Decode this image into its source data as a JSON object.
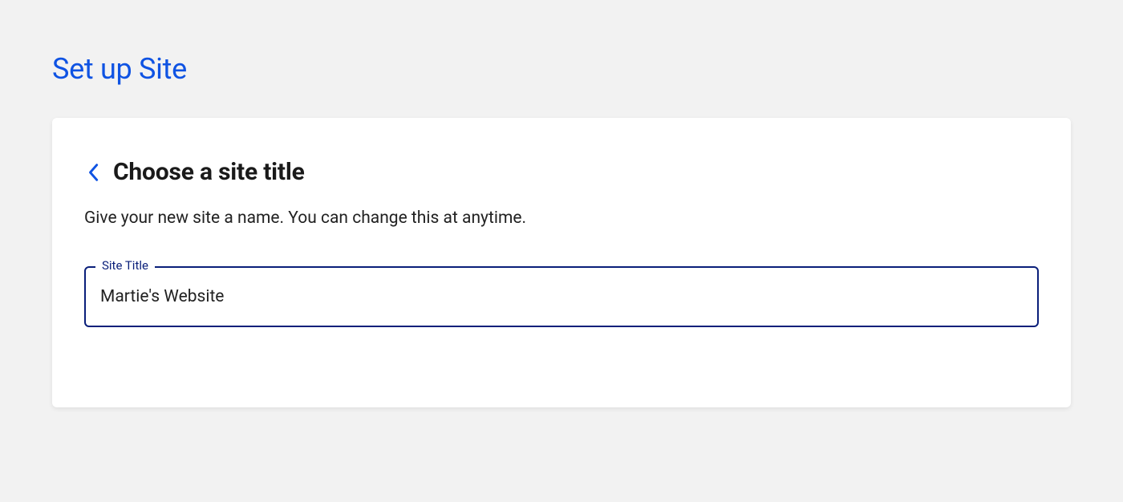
{
  "page": {
    "title": "Set up Site"
  },
  "card": {
    "title": "Choose a site title",
    "subtitle": "Give your new site a name. You can change this at anytime."
  },
  "form": {
    "site_title": {
      "label": "Site Title",
      "value": "Martie's Website"
    }
  },
  "colors": {
    "primary": "#0f53e3",
    "input_border": "#0a1f7a"
  }
}
